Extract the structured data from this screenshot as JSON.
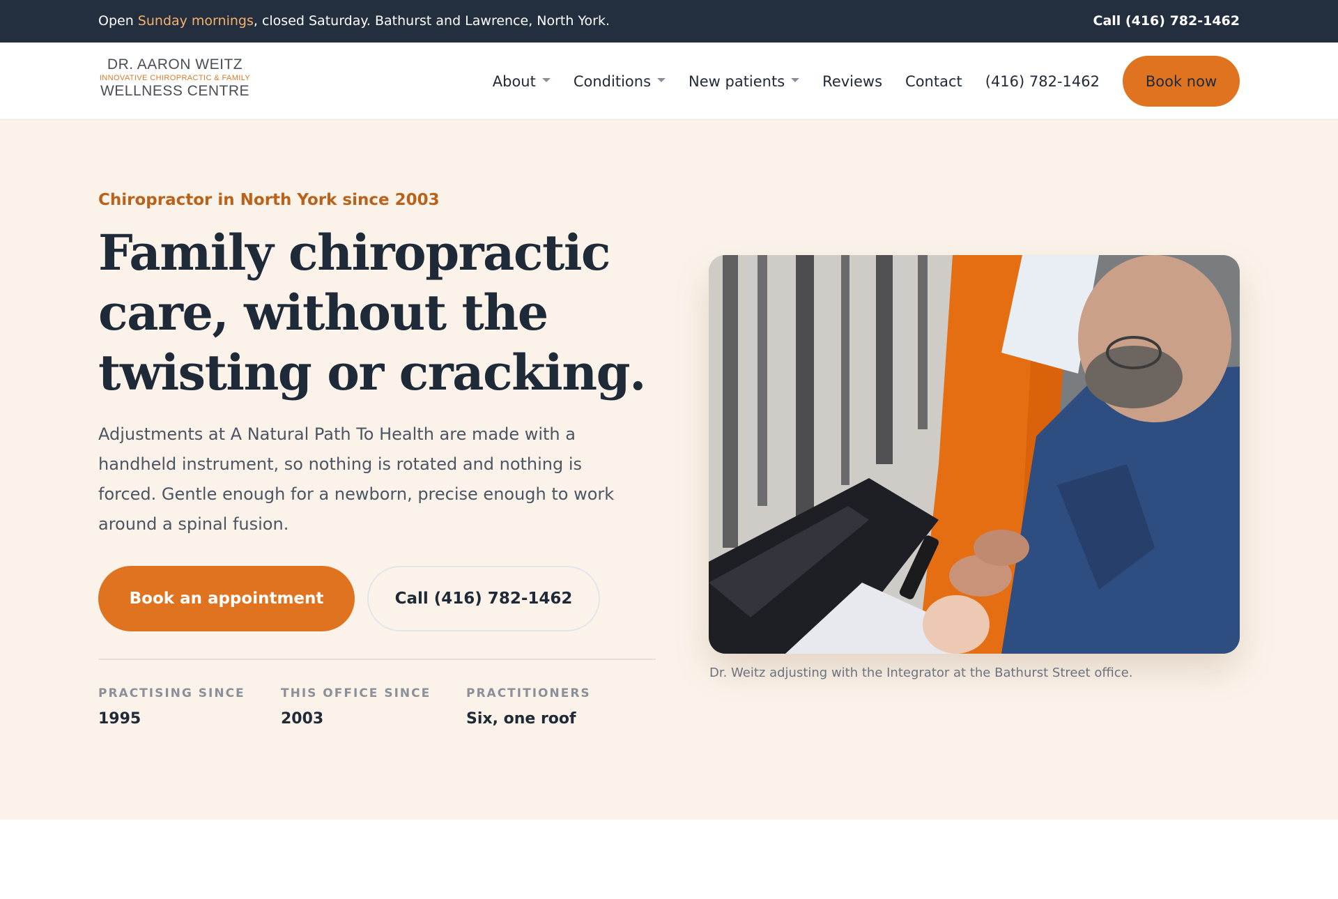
{
  "topbar": {
    "notice_prefix": "Open ",
    "notice_highlight": "Sunday mornings",
    "notice_suffix": ", closed Saturday. Bathurst and Lawrence, North York.",
    "call_label": "Call (416) 782-1462"
  },
  "logo": {
    "line1": "DR. AARON WEITZ",
    "line2": "INNOVATIVE CHIROPRACTIC & FAMILY",
    "line3": "WELLNESS CENTRE"
  },
  "nav": {
    "about": "About",
    "conditions": "Conditions",
    "new_patients": "New patients",
    "reviews": "Reviews",
    "contact": "Contact",
    "phone": "(416) 782-1462",
    "book": "Book now"
  },
  "hero": {
    "eyebrow": "Chiropractor in North York since 2003",
    "headline": "Family chiropractic care, without the twisting or cracking.",
    "lead": "Adjustments at A Natural Path To Health are made with a handheld instrument, so nothing is rotated and nothing is forced. Gentle enough for a newborn, precise enough to work around a spinal fusion.",
    "primary_button": "Book an appointment",
    "secondary_button": "Call (416) 782-1462",
    "stats": [
      {
        "label": "PRACTISING SINCE",
        "value": "1995"
      },
      {
        "label": "THIS OFFICE SINCE",
        "value": "2003"
      },
      {
        "label": "PRACTITIONERS",
        "value": "Six, one roof"
      }
    ],
    "caption": "Dr. Weitz adjusting with the Integrator at the Bathurst Street office."
  },
  "colors": {
    "topbar_bg": "#232f3e",
    "accent": "#e07320",
    "eyebrow": "#b8621b",
    "hero_bg": "#fbf3ea",
    "heading": "#1e2a38"
  }
}
